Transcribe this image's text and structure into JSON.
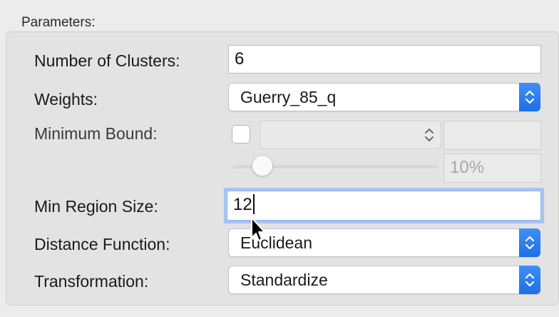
{
  "group_title": "Parameters:",
  "fields": {
    "num_clusters": {
      "label": "Number of Clusters:",
      "value": "6"
    },
    "weights": {
      "label": "Weights:",
      "value": "Guerry_85_q"
    },
    "min_bound": {
      "label": "Minimum Bound:",
      "checked": false,
      "variable": "",
      "value": "",
      "slider_percent": 10,
      "percent_text": "10%"
    },
    "min_region_size": {
      "label": "Min Region Size:",
      "value": "12"
    },
    "distance_function": {
      "label": "Distance Function:",
      "value": "Euclidean"
    },
    "transformation": {
      "label": "Transformation:",
      "value": "Standardize"
    }
  },
  "colors": {
    "accent": "#2a7ff0",
    "focus_ring": "#a5c4f2",
    "panel_bg": "#e3e3e3",
    "window_bg": "#ececec"
  },
  "icons": {
    "select_arrows": "updown-chevron-icon",
    "pointer": "mouse-cursor-icon"
  }
}
